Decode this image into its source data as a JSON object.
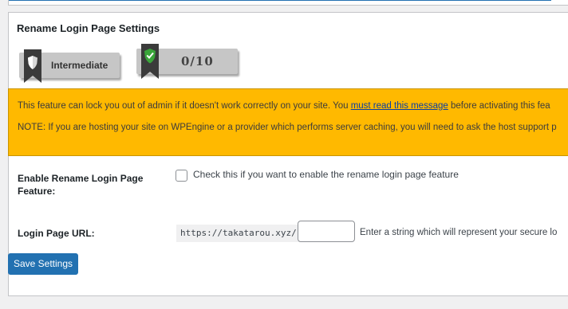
{
  "section": {
    "title": "Rename Login Page Settings"
  },
  "badges": {
    "level_label": "Intermediate",
    "score_label": "0/10"
  },
  "warning": {
    "line1_before": "This feature can lock you out of admin if it doesn't work correctly on your site. You ",
    "link_text": "must read this message",
    "line1_after": " before activating this fea",
    "line2": "NOTE: If you are hosting your site on WPEngine or a provider which performs server caching, you will need to ask the host support p"
  },
  "fields": {
    "enable_label": "Enable Rename Login Page Feature:",
    "enable_help": "Check this if you want to enable the rename login page feature",
    "url_label": "Login Page URL:",
    "url_prefix": "https://takatarou.xyz/",
    "url_value": "",
    "url_help": "Enter a string which will represent your secure lo"
  },
  "actions": {
    "save_label": "Save Settings"
  },
  "colors": {
    "warning_bg": "#ffb900",
    "primary_button": "#2271b1",
    "badge_gray": "#c6c6c6",
    "shield_green": "#3aa53a"
  },
  "icons": {
    "level": "shield-icon",
    "score": "shield-check-icon"
  }
}
